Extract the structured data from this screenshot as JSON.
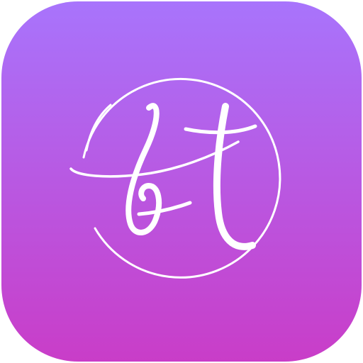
{
  "icon": {
    "monogram": "bt",
    "gradient_top": "#A874FC",
    "gradient_bottom": "#C93DC8",
    "foreground": "#FFFFFF"
  }
}
